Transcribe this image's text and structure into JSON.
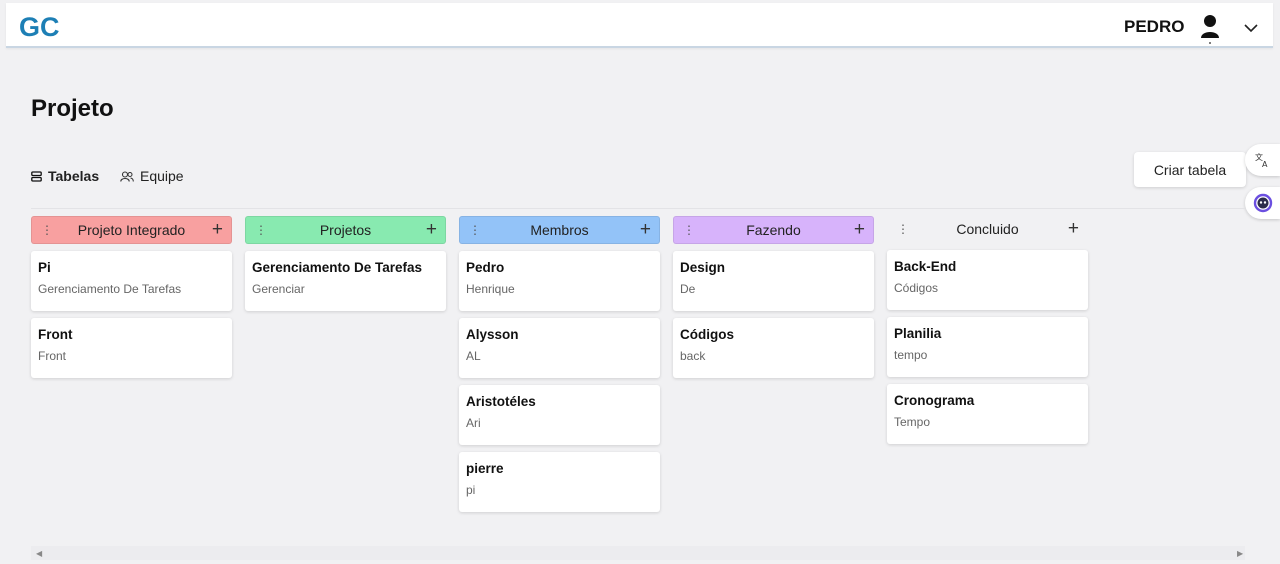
{
  "header": {
    "logo": "GC",
    "user_name": "PEDRO"
  },
  "page": {
    "title": "Projeto"
  },
  "tabs": [
    {
      "label": "Tabelas",
      "icon": "table-stack-icon",
      "active": true
    },
    {
      "label": "Equipe",
      "icon": "people-icon",
      "active": false
    }
  ],
  "actions": {
    "create_table": "Criar tabela"
  },
  "colors": {
    "logo": "#1d7fb5",
    "red_header": "#f8a0a0",
    "green_header": "#88eab0",
    "blue_header": "#93c3f8",
    "purple_header": "#d7b3fb"
  },
  "columns": [
    {
      "title": "Projeto Integrado",
      "color": "#f8a0a0",
      "cards": [
        {
          "title": "Pi",
          "subtitle": "Gerenciamento De Tarefas"
        },
        {
          "title": "Front",
          "subtitle": "Front"
        }
      ]
    },
    {
      "title": "Projetos",
      "color": "#88eab0",
      "cards": [
        {
          "title": "Gerenciamento De Tarefas",
          "subtitle": "Gerenciar"
        }
      ]
    },
    {
      "title": "Membros",
      "color": "#93c3f8",
      "cards": [
        {
          "title": "Pedro",
          "subtitle": "Henrique"
        },
        {
          "title": "Alysson",
          "subtitle": "AL"
        },
        {
          "title": "Aristotéles",
          "subtitle": "Ari"
        },
        {
          "title": "pierre",
          "subtitle": "pi"
        }
      ]
    },
    {
      "title": "Fazendo",
      "color": "#d7b3fb",
      "cards": [
        {
          "title": "Design",
          "subtitle": "De"
        },
        {
          "title": "Códigos",
          "subtitle": "back"
        }
      ]
    },
    {
      "title": "Concluido",
      "color": "transparent",
      "cards": [
        {
          "title": "Back-End",
          "subtitle": "Códigos"
        },
        {
          "title": "Planilia",
          "subtitle": "tempo"
        },
        {
          "title": "Cronograma",
          "subtitle": "Tempo"
        }
      ]
    }
  ]
}
